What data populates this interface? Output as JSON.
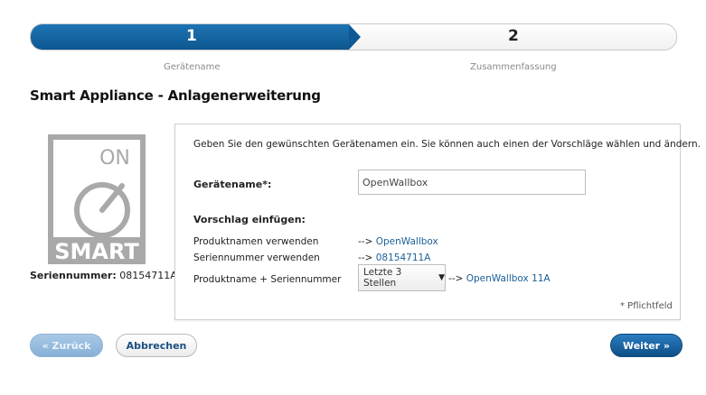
{
  "wizard": {
    "steps": [
      {
        "number": "1",
        "label": "Gerätename",
        "active": true
      },
      {
        "number": "2",
        "label": "Zusammenfassung",
        "active": false
      }
    ]
  },
  "page": {
    "title": "Smart Appliance - Anlagenerweiterung"
  },
  "device": {
    "logo_top": "ON",
    "logo_bottom": "SMART",
    "serial_label": "Seriennummer:",
    "serial_value": "08154711A"
  },
  "form": {
    "intro": "Geben Sie den gewünschten Gerätenamen ein. Sie können auch einen der Vorschläge wählen und ändern.",
    "name_label": "Gerätename*:",
    "name_value": "OpenWallbox",
    "suggestions_heading": "Vorschlag einfügen:",
    "suggestions": [
      {
        "label": "Produktnamen verwenden",
        "arrow": "-->",
        "link": "OpenWallbox"
      },
      {
        "label": "Seriennummer verwenden",
        "arrow": "-->",
        "link": "08154711A"
      },
      {
        "label": "Produktname + Seriennummer",
        "select_value": "Letzte 3 Stellen",
        "arrow": "-->",
        "link": "OpenWallbox 11A"
      }
    ],
    "required_note": "* Pflichtfeld"
  },
  "buttons": {
    "back": "« Zurück",
    "cancel": "Abbrechen",
    "next": "Weiter »"
  },
  "colors": {
    "accent": "#0d5791",
    "link": "#1a5f98",
    "logo_gray": "#a9a9a9"
  }
}
